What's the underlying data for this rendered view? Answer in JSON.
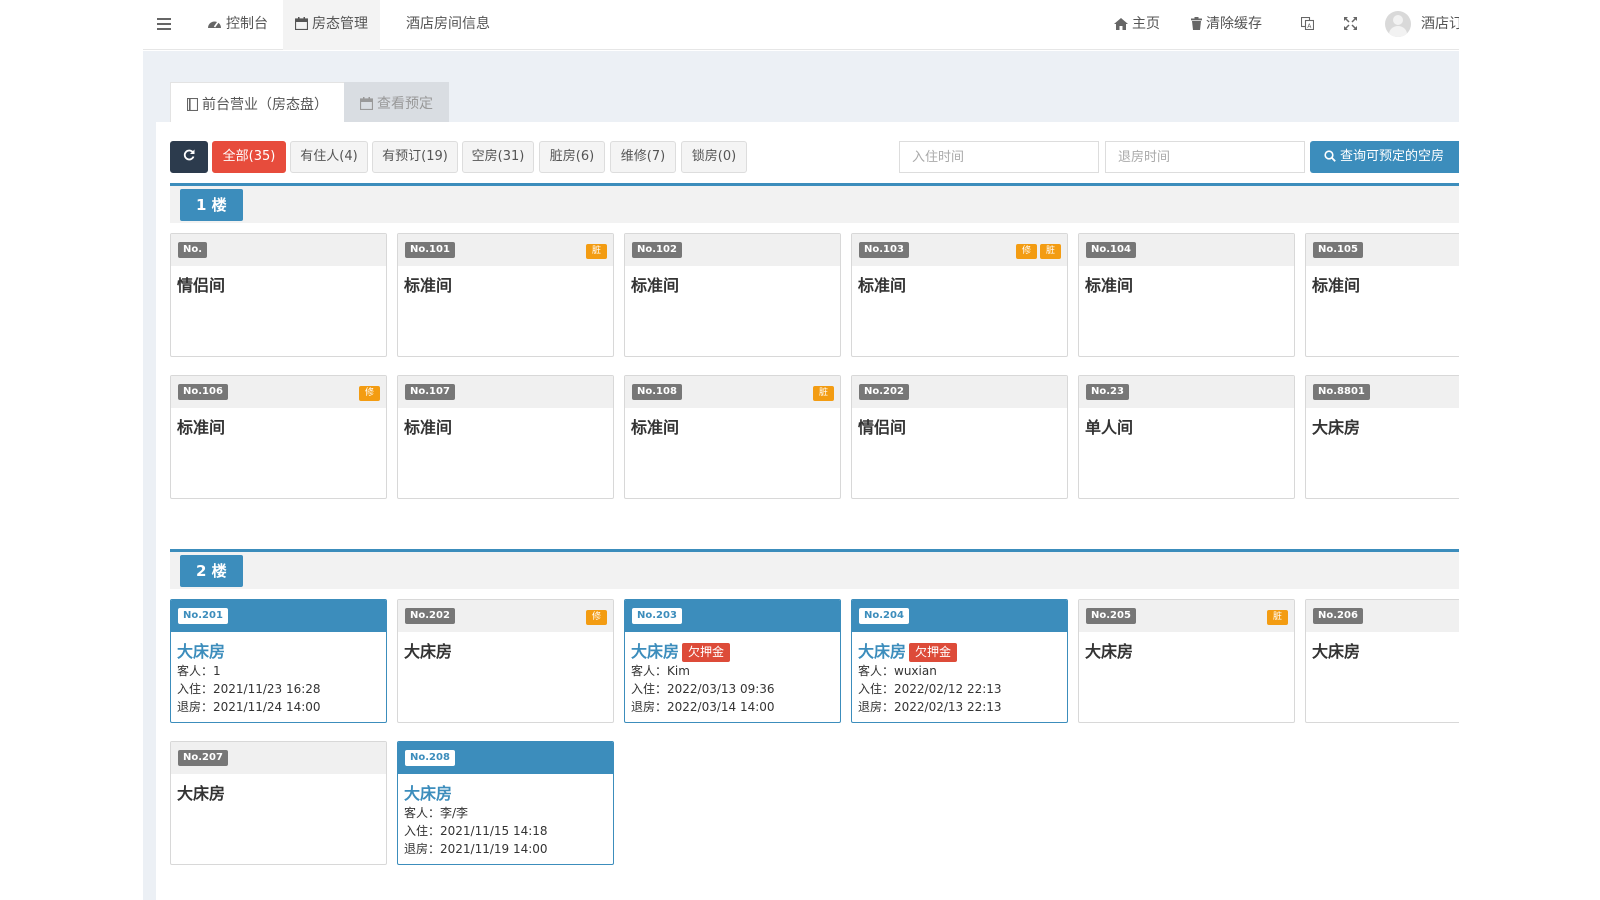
{
  "topbar": {
    "nav": [
      {
        "label": "控制台",
        "icon": "dashboard-icon"
      },
      {
        "label": "房态管理",
        "icon": "calendar-icon"
      },
      {
        "label": "酒店房间信息",
        "icon": ""
      }
    ],
    "home_label": "主页",
    "clear_cache_label": "清除缓存",
    "user_label": "酒店订"
  },
  "tabs": {
    "front_desk": "前台营业（房态盘）",
    "reservations": "查看预定"
  },
  "filters": {
    "all": "全部(35)",
    "occupied": "有住人(4)",
    "reserved": "有预订(19)",
    "vacant": "空房(31)",
    "dirty": "脏房(6)",
    "repair": "维修(7)",
    "locked": "锁房(0)",
    "checkin_placeholder": "入住时间",
    "checkout_placeholder": "退房时间",
    "search_label": "查询可预定的空房"
  },
  "labels": {
    "guest": "客人：",
    "checkin": "入住：",
    "checkout": "退房：",
    "debt": "欠押金"
  },
  "colors": {
    "primary": "#3c8dbc",
    "danger": "#dd4b39",
    "warning": "#f39c12",
    "dark": "#2c3b4d"
  },
  "floors": [
    {
      "label": "1 楼",
      "rooms": [
        {
          "no": "No.",
          "type": "情侣间",
          "badges": []
        },
        {
          "no": "No.101",
          "type": "标准间",
          "badges": [
            "脏"
          ]
        },
        {
          "no": "No.102",
          "type": "标准间",
          "badges": []
        },
        {
          "no": "No.103",
          "type": "标准间",
          "badges": [
            "修",
            "脏"
          ]
        },
        {
          "no": "No.104",
          "type": "标准间",
          "badges": []
        },
        {
          "no": "No.105",
          "type": "标准间",
          "badges": []
        },
        {
          "no": "No.106",
          "type": "标准间",
          "badges": [
            "修"
          ]
        },
        {
          "no": "No.107",
          "type": "标准间",
          "badges": []
        },
        {
          "no": "No.108",
          "type": "标准间",
          "badges": [
            "脏"
          ]
        },
        {
          "no": "No.202",
          "type": "情侣间",
          "badges": []
        },
        {
          "no": "No.23",
          "type": "单人间",
          "badges": []
        },
        {
          "no": "No.8801",
          "type": "大床房",
          "badges": []
        }
      ]
    },
    {
      "label": "2 楼",
      "rooms": [
        {
          "no": "No.201",
          "type": "大床房",
          "badges": [],
          "occupied": true,
          "debt": false,
          "guest": "1",
          "checkin": "2021/11/23 16:28",
          "checkout": "2021/11/24 14:00"
        },
        {
          "no": "No.202",
          "type": "大床房",
          "badges": [
            "修"
          ]
        },
        {
          "no": "No.203",
          "type": "大床房",
          "badges": [],
          "occupied": true,
          "debt": true,
          "guest": "Kim",
          "checkin": "2022/03/13 09:36",
          "checkout": "2022/03/14 14:00"
        },
        {
          "no": "No.204",
          "type": "大床房",
          "badges": [],
          "occupied": true,
          "debt": true,
          "guest": "wuxian",
          "checkin": "2022/02/12 22:13",
          "checkout": "2022/02/13 22:13"
        },
        {
          "no": "No.205",
          "type": "大床房",
          "badges": [
            "脏"
          ]
        },
        {
          "no": "No.206",
          "type": "大床房",
          "badges": []
        },
        {
          "no": "No.207",
          "type": "大床房",
          "badges": []
        },
        {
          "no": "No.208",
          "type": "大床房",
          "badges": [],
          "occupied": true,
          "debt": false,
          "guest": "李/李",
          "checkin": "2021/11/15 14:18",
          "checkout": "2021/11/19 14:00"
        }
      ]
    }
  ]
}
